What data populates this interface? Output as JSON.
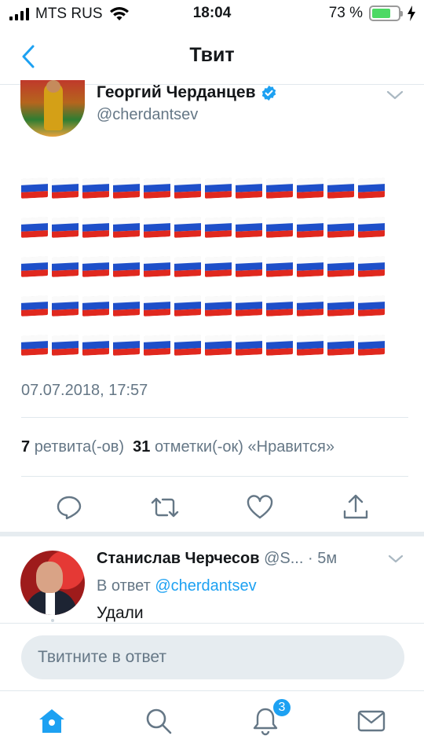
{
  "status_bar": {
    "carrier": "MTS RUS",
    "time": "18:04",
    "battery_percent_label": "73 %",
    "battery_level": 0.73,
    "icons": [
      "signal-icon",
      "wifi-icon",
      "battery-icon",
      "charging-icon"
    ]
  },
  "header": {
    "title": "Твит",
    "back_icon": "chevron-left-icon"
  },
  "tweet": {
    "author_name": "Георгий Черданцев",
    "author_handle": "@cherdantsev",
    "verified": true,
    "flag_emoji": "🇷🇺",
    "flag_rows": 5,
    "flags_per_row": 12,
    "timestamp": "07.07.2018, 17:57",
    "retweets_count": "7",
    "retweets_label": "ретвита(-ов)",
    "likes_count": "31",
    "likes_label": "отметки(-ок) «Нравится»",
    "actions": [
      "reply-icon",
      "retweet-icon",
      "like-icon",
      "share-icon"
    ]
  },
  "reply": {
    "author_name": "Станислав Черчесов",
    "author_handle": "@S...",
    "age": "· 5м",
    "reply_to_prefix": "В ответ",
    "reply_to_handle": "@cherdantsev",
    "text": "Удали"
  },
  "composer": {
    "placeholder": "Твитните в ответ"
  },
  "tabbar": {
    "items": [
      "home-icon",
      "search-icon",
      "notifications-icon",
      "messages-icon"
    ],
    "notifications_badge": "3"
  },
  "colors": {
    "accent": "#1da1f2",
    "secondary_text": "#657786",
    "divider": "#e1e8ed",
    "battery": "#4cd964"
  }
}
